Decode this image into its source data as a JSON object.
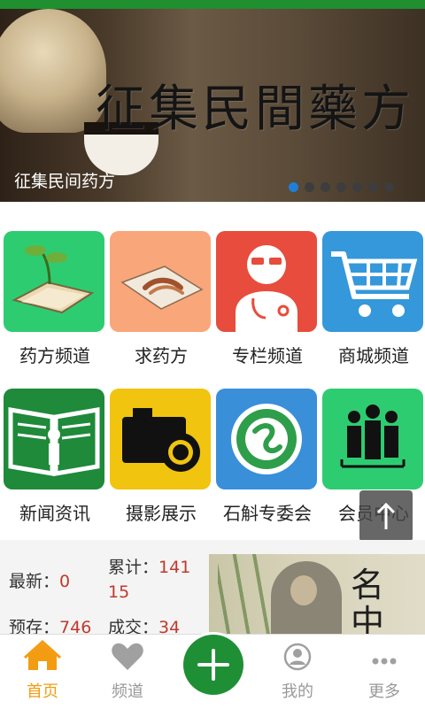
{
  "banner": {
    "calligraphy": "征集民間藥方",
    "caption": "征集民间药方",
    "dots_total": 7,
    "active_dot": 1
  },
  "tiles": [
    {
      "label": "药方频道",
      "icon": "sprout-book-icon",
      "color": "#2ecc71"
    },
    {
      "label": "求药方",
      "icon": "herbs-paper-icon",
      "color": "#f9a67a"
    },
    {
      "label": "专栏频道",
      "icon": "doctor-icon",
      "color": "#e74c3c"
    },
    {
      "label": "商城频道",
      "icon": "cart-icon",
      "color": "#3498db"
    },
    {
      "label": "新闻资讯",
      "icon": "info-book-icon",
      "color": "#1e8a3a"
    },
    {
      "label": "摄影展示",
      "icon": "camera-icon",
      "color": "#f1c40f"
    },
    {
      "label": "石斛专委会",
      "icon": "society-logo-icon",
      "color": "#3a8fd9"
    },
    {
      "label": "会员中心",
      "icon": "members-icon",
      "color": "#2ecc71"
    }
  ],
  "stats": {
    "latest_label": "最新：",
    "latest_value": "0",
    "total_label": "累计：",
    "total_value_line1": "141",
    "total_value_line2": "15",
    "stock_label": "预存：",
    "stock_value": "746",
    "deal_label": "成交：",
    "deal_value": "34"
  },
  "ad": {
    "chars": [
      "名",
      "中"
    ]
  },
  "nav": {
    "home": "首页",
    "channel": "频道",
    "mine": "我的",
    "more": "更多"
  },
  "colors": {
    "accent_green": "#1f8f36",
    "active_orange": "#f39c12",
    "number_red": "#c0392b",
    "dot_blue": "#1f7fd8"
  }
}
